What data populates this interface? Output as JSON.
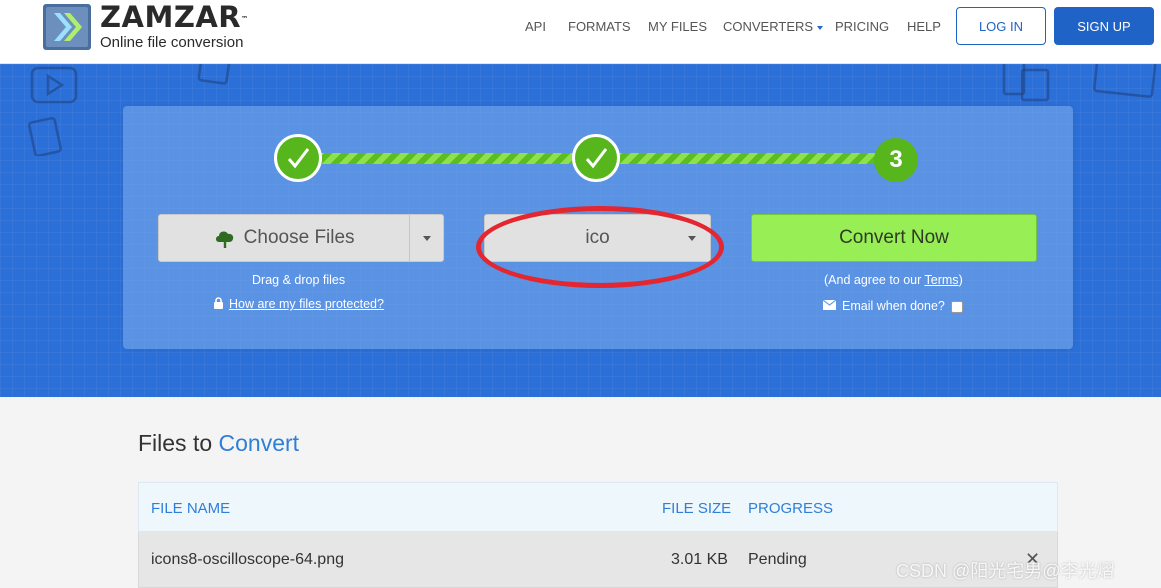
{
  "brand": {
    "name": "ZAMZAR",
    "tm": "™",
    "tagline": "Online file conversion"
  },
  "nav": {
    "items": [
      "API",
      "FORMATS",
      "MY FILES",
      "CONVERTERS",
      "PRICING",
      "HELP"
    ],
    "login_label": "LOG IN",
    "signup_label": "SIGN UP"
  },
  "colors": {
    "accent": "#1e63c5",
    "hero": "#2b6fd8",
    "step": "#56b61c",
    "convert": "#97ef55",
    "highlight": "#e3262f"
  },
  "steps": {
    "step3_label": "3",
    "step1_done": true,
    "step2_done": true
  },
  "upload": {
    "choose_label": "Choose Files",
    "drag_hint": "Drag & drop files",
    "protect_link": "How are my files protected?"
  },
  "format": {
    "selected": "ico"
  },
  "convert": {
    "button_label": "Convert Now",
    "agree_prefix": "(And agree to our ",
    "terms_link": "Terms",
    "agree_suffix": ")",
    "email_label": "Email when done?"
  },
  "files": {
    "title_plain": "Files to ",
    "title_accent": "Convert",
    "columns": [
      "FILE NAME",
      "FILE SIZE",
      "PROGRESS"
    ],
    "rows": [
      {
        "name": "icons8-oscilloscope-64.png",
        "size": "3.01 KB",
        "progress": "Pending"
      }
    ]
  },
  "watermark": "CSDN @阳光宅男@李光熠"
}
